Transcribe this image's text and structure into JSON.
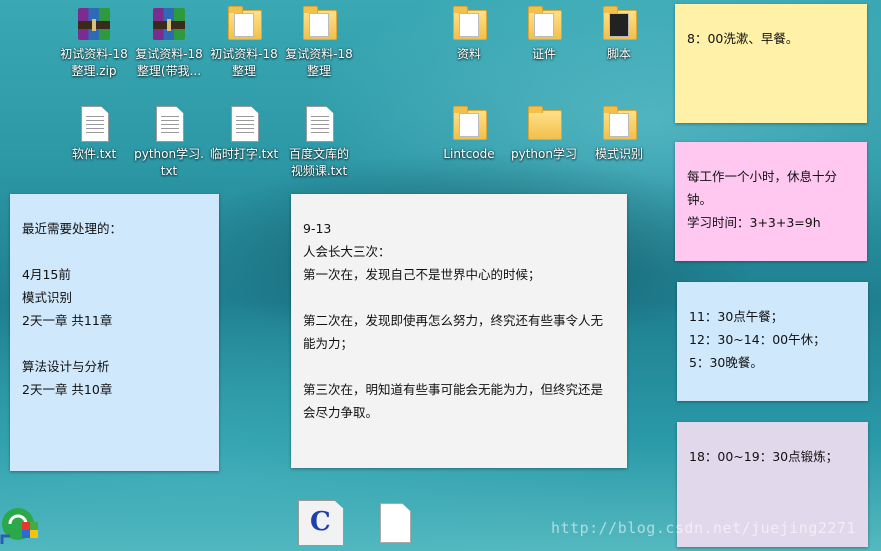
{
  "desktop_icons": {
    "row1": [
      {
        "label": "初试资料-18\n整理.zip"
      },
      {
        "label": "复试资料-18\n整理(带我..."
      },
      {
        "label": "初试资料-18\n整理"
      },
      {
        "label": "复试资料-18\n整理"
      },
      {
        "label": "资料"
      },
      {
        "label": "证件"
      },
      {
        "label": "脚本"
      }
    ],
    "row2": [
      {
        "label": "软件.txt"
      },
      {
        "label": "python学习.\ntxt"
      },
      {
        "label": "临时打字.txt"
      },
      {
        "label": "百度文库的\n视频课.txt"
      },
      {
        "label": "Lintcode"
      },
      {
        "label": "python学习"
      },
      {
        "label": "模式识别"
      }
    ]
  },
  "sticky_notes": [
    {
      "text": "\n最近需要处理的：\n\n4月15前\n模式识别\n2天一章 共11章\n\n算法设计与分析\n2天一章 共10章",
      "color": "#cfe8fc"
    },
    {
      "text": "\n9-13\n人会长大三次：\n第一次在，发现自己不是世界中心的时候；\n\n第二次在，发现即使再怎么努力，终究还有些事令人无能为力；\n\n第三次在，明知道有些事可能会无能为力，但终究还是会尽力争取。",
      "color": "#f3f3f3"
    },
    {
      "text": "\n8：00洗漱、早餐。",
      "color": "#fff2a8"
    },
    {
      "text": "\n每工作一个小时，休息十分钟。\n学习时间：3+3+3=9h",
      "color": "#ffc8f0"
    },
    {
      "text": "\n11：30点午餐；\n12：30~14：00午休；\n5：30晚餐。",
      "color": "#cfe8fc"
    },
    {
      "text": "\n18：00~19：30点锻炼；",
      "color": "#e2d8ec"
    }
  ],
  "taskbar_icons": {
    "c_label": "C"
  },
  "watermark": "http://blog.csdn.net/juejing2271"
}
